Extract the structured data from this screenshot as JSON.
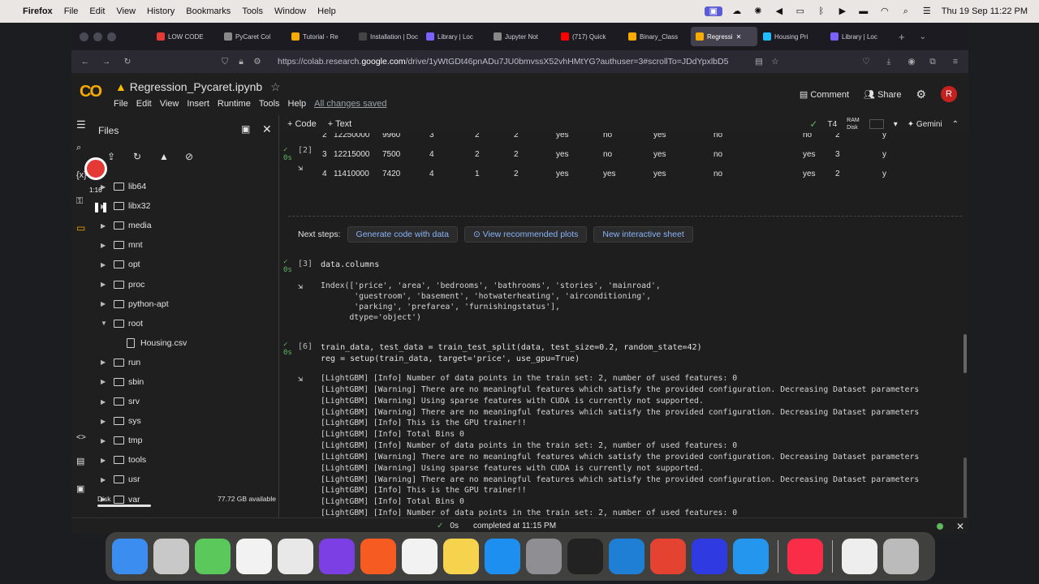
{
  "macos": {
    "app": "Firefox",
    "menus": [
      "File",
      "Edit",
      "View",
      "History",
      "Bookmarks",
      "Tools",
      "Window",
      "Help"
    ],
    "datetime": "Thu 19 Sep 11:22 PM"
  },
  "browser": {
    "tabs": [
      {
        "label": "LOW CODE",
        "color": "#e53935"
      },
      {
        "label": "PyCaret Col",
        "color": "#888888"
      },
      {
        "label": "Tutorial - Re",
        "color": "#f9ab00"
      },
      {
        "label": "Installation | Doc",
        "color": "#444444"
      },
      {
        "label": "Library | Loc",
        "color": "#7b61ff"
      },
      {
        "label": "Jupyter Not",
        "color": "#888888"
      },
      {
        "label": "(717) Quick",
        "color": "#ff0000"
      },
      {
        "label": "Binary_Class",
        "color": "#f9ab00"
      },
      {
        "label": "Regressi",
        "color": "#f9ab00",
        "active": true
      },
      {
        "label": "Housing Pri",
        "color": "#20beff"
      },
      {
        "label": "Library | Loc",
        "color": "#7b61ff"
      }
    ],
    "url_prefix": "https://colab.research.",
    "url_domain": "google.com",
    "url_rest": "/drive/1yWtGDt46pnADu7JU0bmvssX52vhHMtYG?authuser=3#scrollTo=JDdYpxlbD5"
  },
  "colab": {
    "filename": "Regression_Pycaret.ipynb",
    "menus": [
      "File",
      "Edit",
      "View",
      "Insert",
      "Runtime",
      "Tools",
      "Help"
    ],
    "saved_status": "All changes saved",
    "comment": "Comment",
    "share": "Share",
    "avatar": "R",
    "toolbar": {
      "code": "+ Code",
      "text": "+ Text",
      "runtime": "T4",
      "ram": "RAM",
      "disk": "Disk",
      "gemini": "Gemini"
    }
  },
  "files_panel": {
    "title": "Files",
    "items": [
      {
        "name": "lib64"
      },
      {
        "name": "libx32"
      },
      {
        "name": "media"
      },
      {
        "name": "mnt"
      },
      {
        "name": "opt"
      },
      {
        "name": "proc"
      },
      {
        "name": "python-apt"
      },
      {
        "name": "root",
        "expanded": true
      },
      {
        "name": "Housing.csv",
        "file": true
      },
      {
        "name": "run"
      },
      {
        "name": "sbin"
      },
      {
        "name": "srv"
      },
      {
        "name": "sys"
      },
      {
        "name": "tmp"
      },
      {
        "name": "tools"
      },
      {
        "name": "usr"
      },
      {
        "name": "var"
      }
    ],
    "disk_label": "Disk",
    "disk_available": "77.72 GB available"
  },
  "recording": {
    "time": "1:16"
  },
  "notebook": {
    "cell2": {
      "num": "[2]",
      "rows": [
        [
          "2",
          "12250000",
          "9960",
          "3",
          "2",
          "2",
          "yes",
          "no",
          "yes",
          "no",
          "no",
          "2",
          "y"
        ],
        [
          "3",
          "12215000",
          "7500",
          "4",
          "2",
          "2",
          "yes",
          "no",
          "yes",
          "no",
          "yes",
          "3",
          "y"
        ],
        [
          "4",
          "11410000",
          "7420",
          "4",
          "1",
          "2",
          "yes",
          "yes",
          "yes",
          "no",
          "yes",
          "2",
          "y"
        ]
      ]
    },
    "next_steps": {
      "label": "Next steps:",
      "buttons": [
        "Generate code with data",
        "View recommended plots",
        "New interactive sheet"
      ]
    },
    "cell3": {
      "num": "[3]",
      "code": "data.columns",
      "output": "Index(['price', 'area', 'bedrooms', 'bathrooms', 'stories', 'mainroad',\n       'guestroom', 'basement', 'hotwaterheating', 'airconditioning',\n       'parking', 'prefarea', 'furnishingstatus'],\n      dtype='object')"
    },
    "cell6": {
      "num": "[6]",
      "code_line1": "train_data, test_data = train_test_split(data, test_size=0.2, random_state=42)",
      "code_line2": "reg = setup(train_data, target='price', use_gpu=True)",
      "output": "[LightGBM] [Info] Number of data points in the train set: 2, number of used features: 0\n[LightGBM] [Warning] There are no meaningful features which satisfy the provided configuration. Decreasing Dataset parameters\n[LightGBM] [Warning] Using sparse features with CUDA is currently not supported.\n[LightGBM] [Warning] There are no meaningful features which satisfy the provided configuration. Decreasing Dataset parameters\n[LightGBM] [Info] This is the GPU trainer!!\n[LightGBM] [Info] Total Bins 0\n[LightGBM] [Info] Number of data points in the train set: 2, number of used features: 0\n[LightGBM] [Warning] There are no meaningful features which satisfy the provided configuration. Decreasing Dataset parameters\n[LightGBM] [Warning] Using sparse features with CUDA is currently not supported.\n[LightGBM] [Warning] There are no meaningful features which satisfy the provided configuration. Decreasing Dataset parameters\n[LightGBM] [Info] This is the GPU trainer!!\n[LightGBM] [Info] Total Bins 0\n[LightGBM] [Info] Number of data points in the train set: 2, number of used features: 0\n[LightGBM] [Warning] There are no meaningful features which satisfy the provided configuration. Decreasing Dataset parameters"
    }
  },
  "statusbar": {
    "elapsed": "0s",
    "completed": "completed at 11:15 PM"
  },
  "dock": [
    "finder",
    "launchpad",
    "maps",
    "photos",
    "chrome",
    "firefox",
    "brave",
    "reminders",
    "notes",
    "app-store",
    "system-settings",
    "terminal",
    "vscode",
    "todoist",
    "perplexity",
    "docker",
    "music",
    "file",
    "trash"
  ]
}
